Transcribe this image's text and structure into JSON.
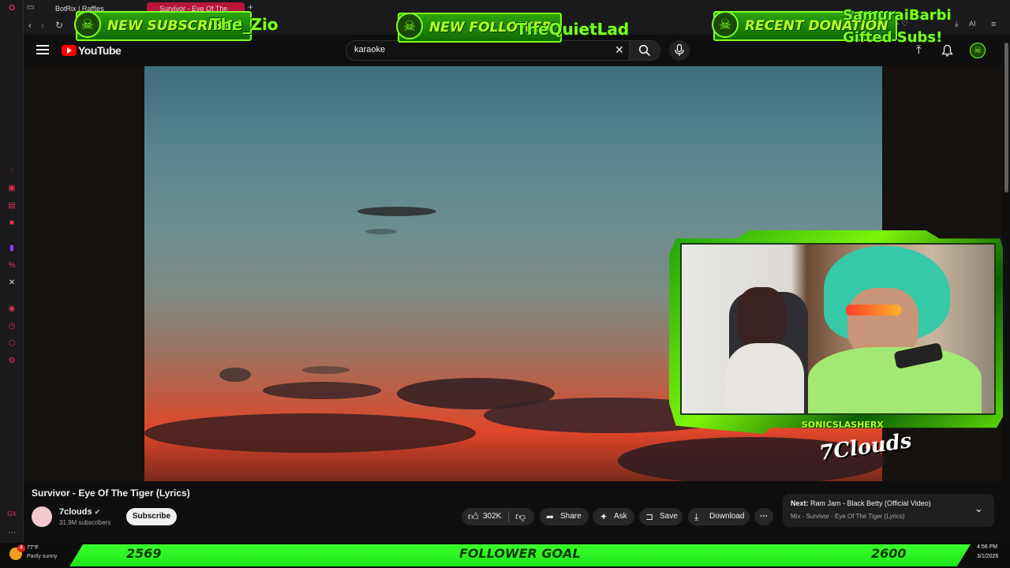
{
  "browser": {
    "tabs": [
      {
        "label": "BotRix | Raffles"
      },
      {
        "label": "Survivor - Eye Of The"
      }
    ],
    "new_tab_glyph": "+"
  },
  "youtube": {
    "logo_text": "YouTube",
    "search_value": "karaoke",
    "video_title": "Survivor - Eye Of The Tiger (Lyrics)",
    "channel": {
      "name": "7clouds",
      "subscribers": "31.9M subscribers",
      "avatar_color": "#f4c8cf"
    },
    "subscribe_label": "Subscribe",
    "like_count": "302K",
    "actions": {
      "share": "Share",
      "ask": "Ask",
      "save": "Save",
      "download": "Download"
    },
    "next": {
      "prefix": "Next:",
      "title": "Ram Jam - Black Betty (Official Video)",
      "mix": "Mix - Survivor - Eye Of The Tiger (Lyrics)"
    },
    "video_watermark": "7Clouds"
  },
  "overlay": {
    "subscriber": {
      "label": "NEW SUBSCRIBER",
      "name": "The_Zio"
    },
    "follower": {
      "label": "NEW FOLLOWER",
      "name": "TheQuietLad"
    },
    "donation": {
      "label": "RECENT DONATION",
      "name": "SamuraiBarbi",
      "detail": "Gifted Subs!"
    },
    "webcam_tag": "SONICSLASHERX",
    "goal": {
      "current": "2569",
      "label": "FOLLOWER GOAL",
      "target": "2600"
    },
    "accent": "#7dff22"
  },
  "taskbar": {
    "weather_temp": "77°F",
    "weather_desc": "Partly sunny",
    "notification_count": "4",
    "time": "4:56 PM",
    "date": "3/1/2026"
  }
}
